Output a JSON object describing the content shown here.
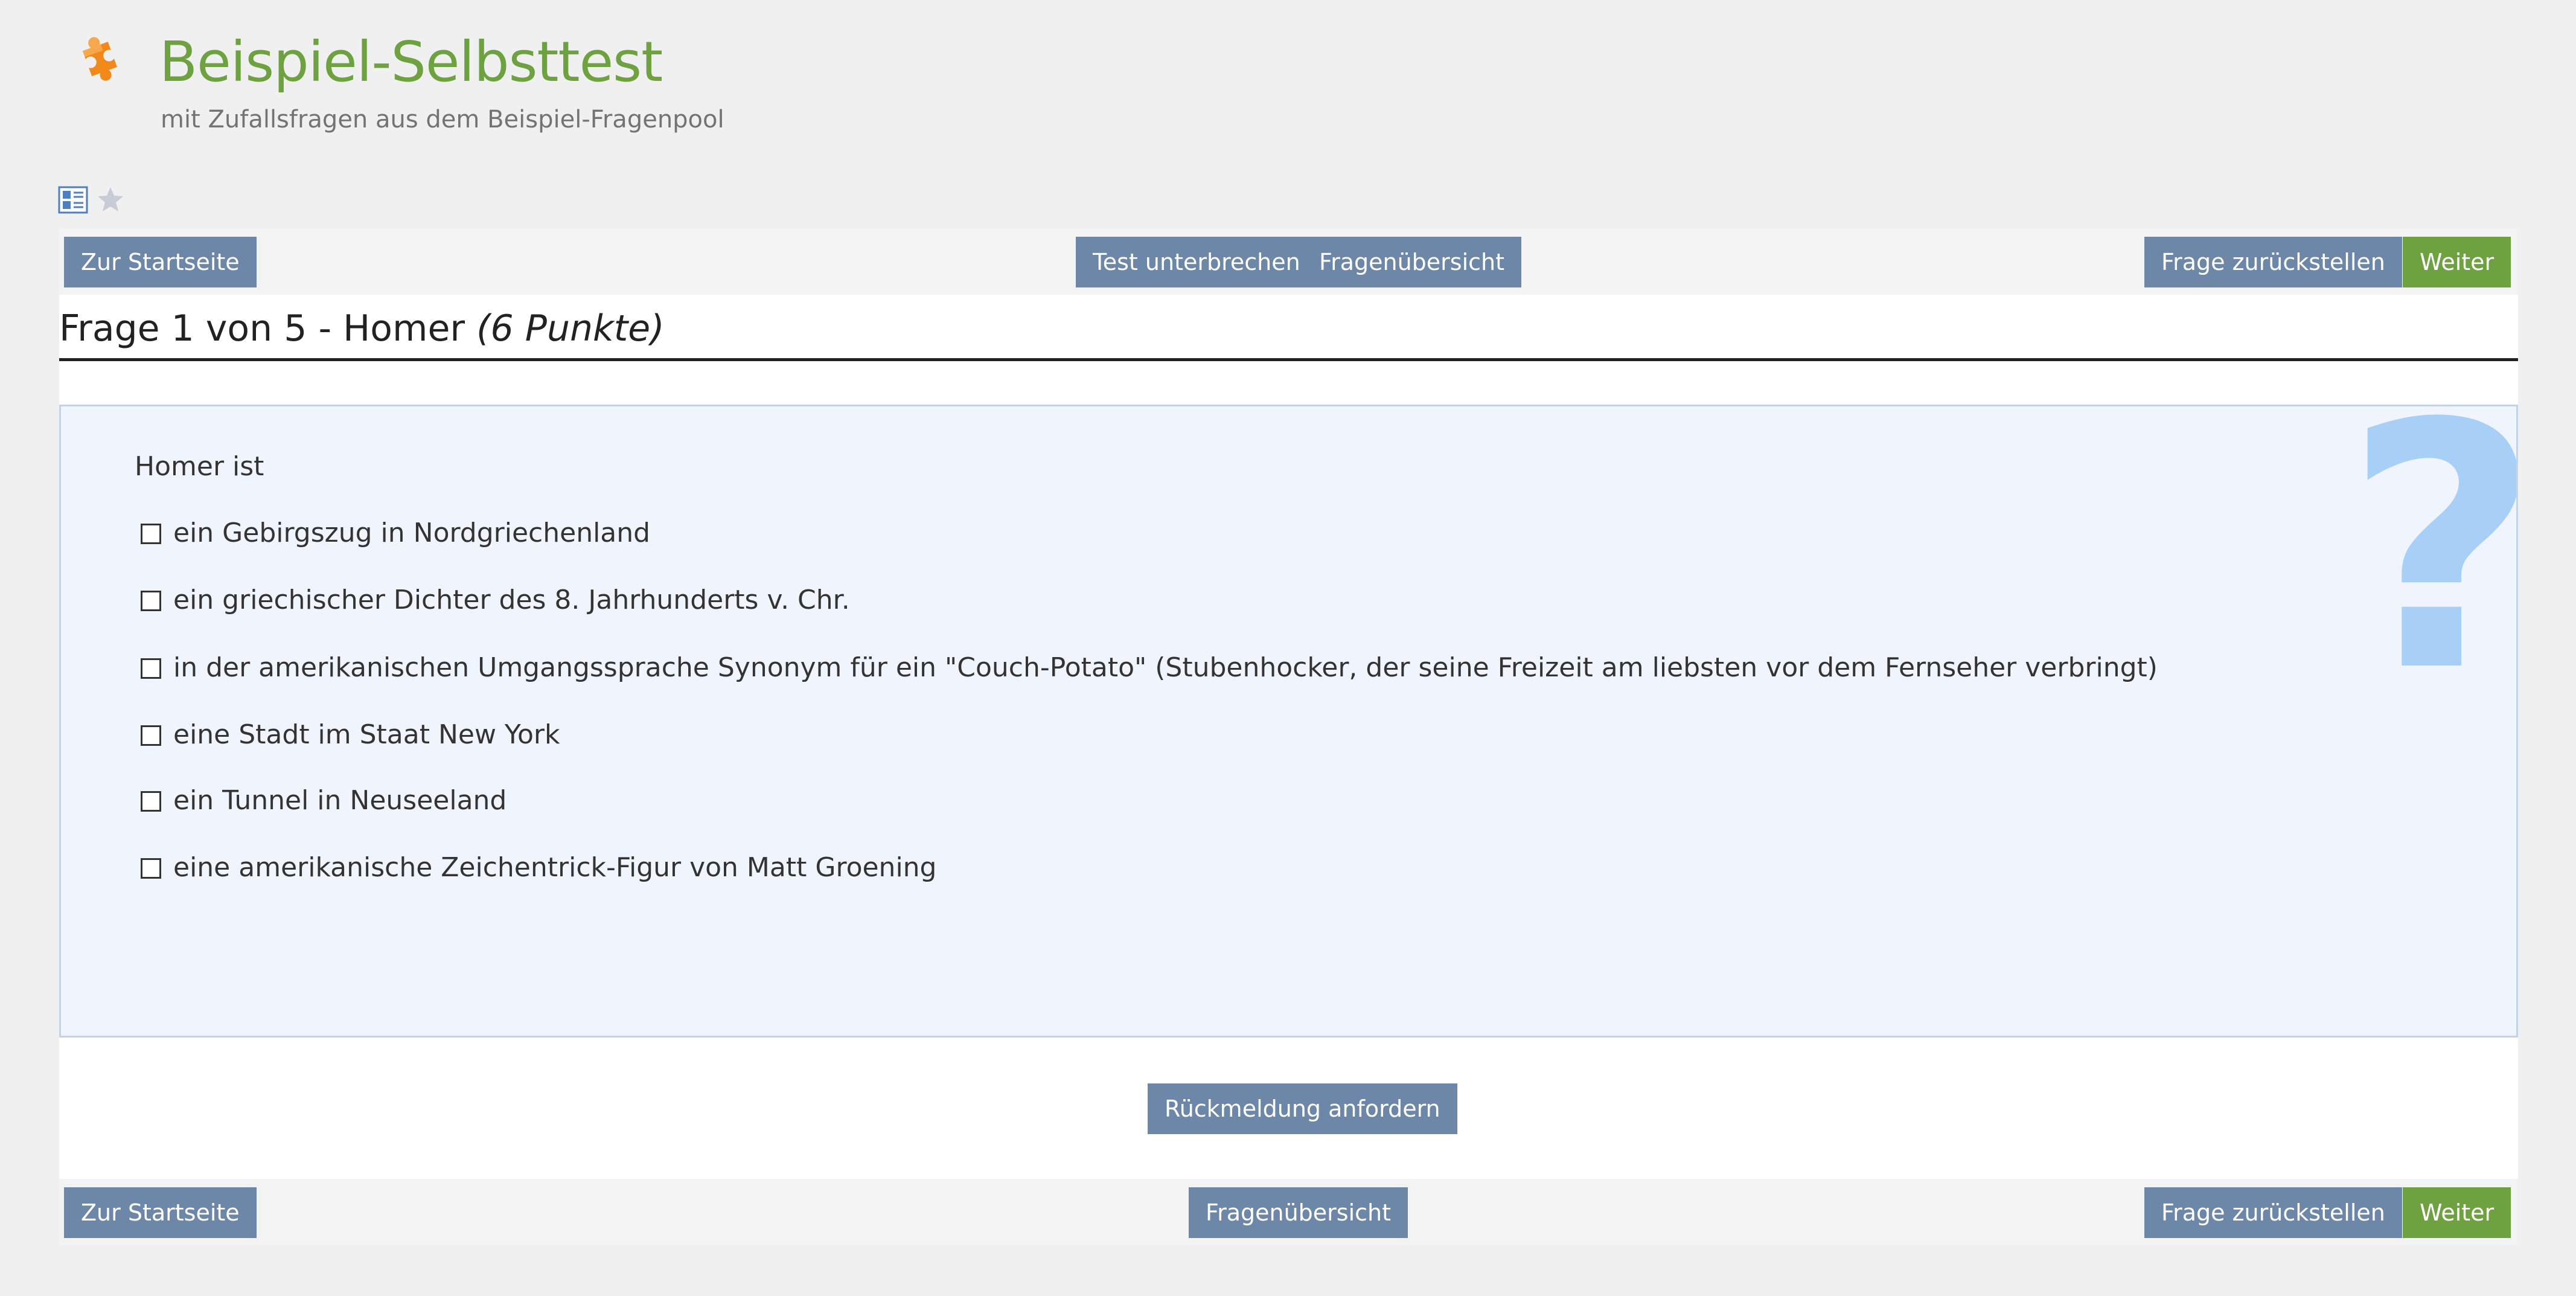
{
  "header": {
    "title": "Beispiel-Selbsttest",
    "subtitle": "mit Zufallsfragen aus dem Beispiel-Fragenpool",
    "icon": "puzzle-icon"
  },
  "view_icons": [
    "list-view-icon",
    "star-icon"
  ],
  "top_nav": {
    "start": "Zur Startseite",
    "suspend": "Test unterbrechen",
    "overview": "Fragenübersicht",
    "postpone": "Frage zurückstellen",
    "next": "Weiter"
  },
  "question": {
    "heading": "Frage 1 von 5 - Homer ",
    "points": "(6 Punkte)",
    "stem": "Homer ist",
    "options": [
      "ein Gebirgszug in Nordgriechenland",
      "ein griechischer Dichter des 8. Jahrhunderts v. Chr.",
      "in der amerikanischen Umgangssprache Synonym für ein \"Couch-Potato\" (Stubenhocker, der seine Freizeit am liebsten vor dem Fernseher verbringt)",
      "eine Stadt im Staat New York",
      "ein Tunnel in Neuseeland",
      "eine amerikanische Zeichentrick-Figur von Matt Groening"
    ],
    "watermark": "?"
  },
  "feedback_button": "Rückmeldung anfordern",
  "bottom_nav": {
    "start": "Zur Startseite",
    "overview": "Fragenübersicht",
    "postpone": "Frage zurückstellen",
    "next": "Weiter"
  },
  "colors": {
    "title_green": "#6ea13f",
    "button_blue": "#6d87a8",
    "button_green": "#6ea13f",
    "question_bg": "#f0f5fd",
    "watermark": "#a8d0f7",
    "puzzle_orange": "#f0891a"
  }
}
